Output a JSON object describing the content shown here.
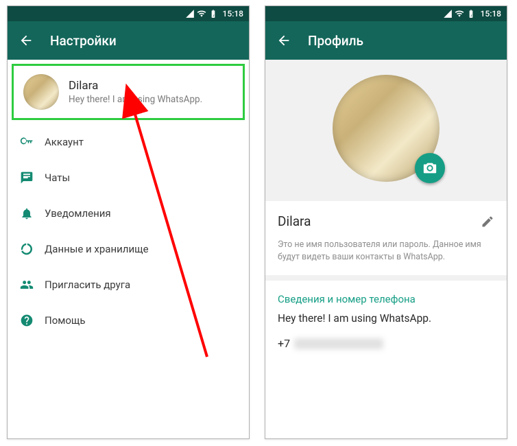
{
  "statusbar": {
    "time": "15:18"
  },
  "left": {
    "title": "Настройки",
    "profile": {
      "name": "Dilara",
      "status": "Hey there! I am using WhatsApp."
    },
    "items": [
      {
        "label": "Аккаунт"
      },
      {
        "label": "Чаты"
      },
      {
        "label": "Уведомления"
      },
      {
        "label": "Данные и хранилище"
      },
      {
        "label": "Пригласить друга"
      },
      {
        "label": "Помощь"
      }
    ]
  },
  "right": {
    "title": "Профиль",
    "name": "Dilara",
    "hint": "Это не имя пользователя или пароль. Данное имя будут видеть ваши контакты в WhatsApp.",
    "section_title": "Сведения и номер телефона",
    "about": "Hey there! I am using WhatsApp.",
    "phone_prefix": "+7"
  }
}
